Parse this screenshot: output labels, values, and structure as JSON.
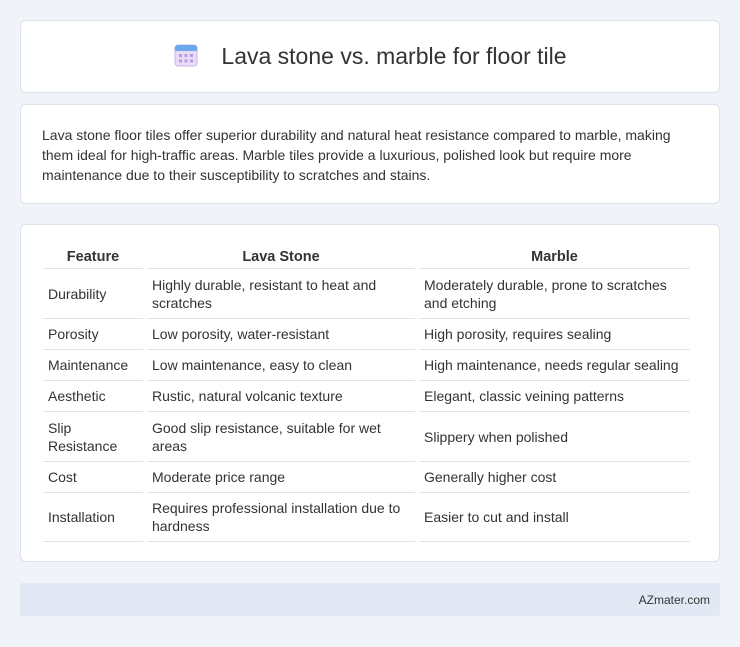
{
  "header": {
    "title": "Lava stone vs. marble for floor tile",
    "icon": "calendar-icon"
  },
  "intro": {
    "text": "Lava stone floor tiles offer superior durability and natural heat resistance compared to marble, making them ideal for high-traffic areas. Marble tiles provide a luxurious, polished look but require more maintenance due to their susceptibility to scratches and stains."
  },
  "table": {
    "headers": [
      "Feature",
      "Lava Stone",
      "Marble"
    ],
    "rows": [
      [
        "Durability",
        "Highly durable, resistant to heat and scratches",
        "Moderately durable, prone to scratches and etching"
      ],
      [
        "Porosity",
        "Low porosity, water-resistant",
        "High porosity, requires sealing"
      ],
      [
        "Maintenance",
        "Low maintenance, easy to clean",
        "High maintenance, needs regular sealing"
      ],
      [
        "Aesthetic",
        "Rustic, natural volcanic texture",
        "Elegant, classic veining patterns"
      ],
      [
        "Slip Resistance",
        "Good slip resistance, suitable for wet areas",
        "Slippery when polished"
      ],
      [
        "Cost",
        "Moderate price range",
        "Generally higher cost"
      ],
      [
        "Installation",
        "Requires professional installation due to hardness",
        "Easier to cut and install"
      ]
    ]
  },
  "footer": {
    "text": "AZmater.com"
  }
}
